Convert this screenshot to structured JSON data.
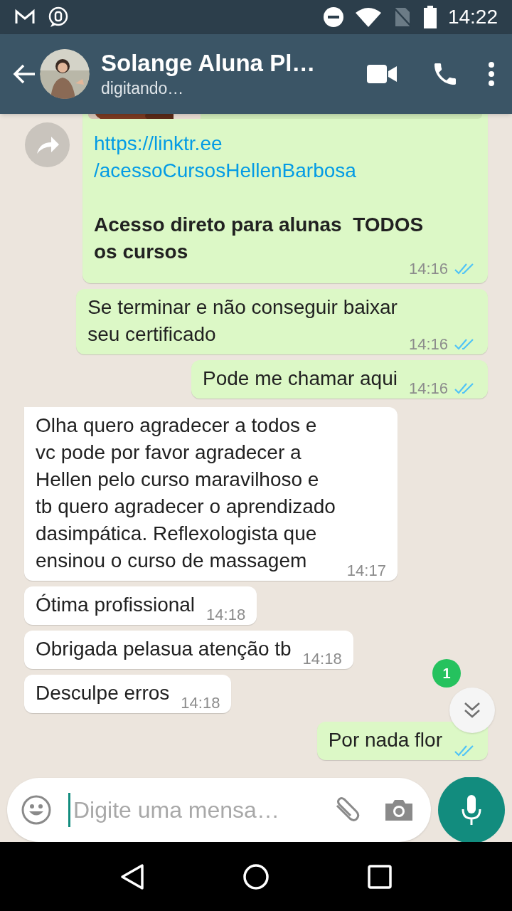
{
  "status_bar": {
    "time": "14:22"
  },
  "header": {
    "name": "Solange Aluna Pl…",
    "status": "digitando…"
  },
  "messages": [
    {
      "kind": "link",
      "outgoing": true,
      "link_lines": [
        "https://linktr.ee",
        "/acessoCursosHellenBarbosa"
      ],
      "text": "Acesso direto para alunas  TODOS os cursos",
      "time": "14:16",
      "read": true
    },
    {
      "kind": "text",
      "outgoing": true,
      "text": "Se terminar e não conseguir baixar\nseu certificado",
      "time": "14:16",
      "read": true
    },
    {
      "kind": "text",
      "outgoing": true,
      "text": "Pode me chamar aqui",
      "time": "14:16",
      "read": true
    },
    {
      "kind": "text",
      "outgoing": false,
      "tail": true,
      "text": "Olha quero agradecer a todos e\nvc pode por favor agradecer a\nHellen pelo curso maravilhoso e\ntb quero agradecer o aprendizado\ndasimpática. Reflexologista que\nensinou o curso de massagem",
      "time": "14:17"
    },
    {
      "kind": "text",
      "outgoing": false,
      "text": "Ótima profissional",
      "time": "14:18"
    },
    {
      "kind": "text",
      "outgoing": false,
      "text": "Obrigada pelasua atenção tb",
      "time": "14:18"
    },
    {
      "kind": "text",
      "outgoing": false,
      "text": "Desculpe erros",
      "time": "14:18"
    },
    {
      "kind": "text",
      "outgoing": true,
      "tail": true,
      "text": "Por nada flor",
      "read": true
    }
  ],
  "scroll_button": {
    "badge": "1"
  },
  "composer": {
    "placeholder": "Digite uma mensa…"
  }
}
